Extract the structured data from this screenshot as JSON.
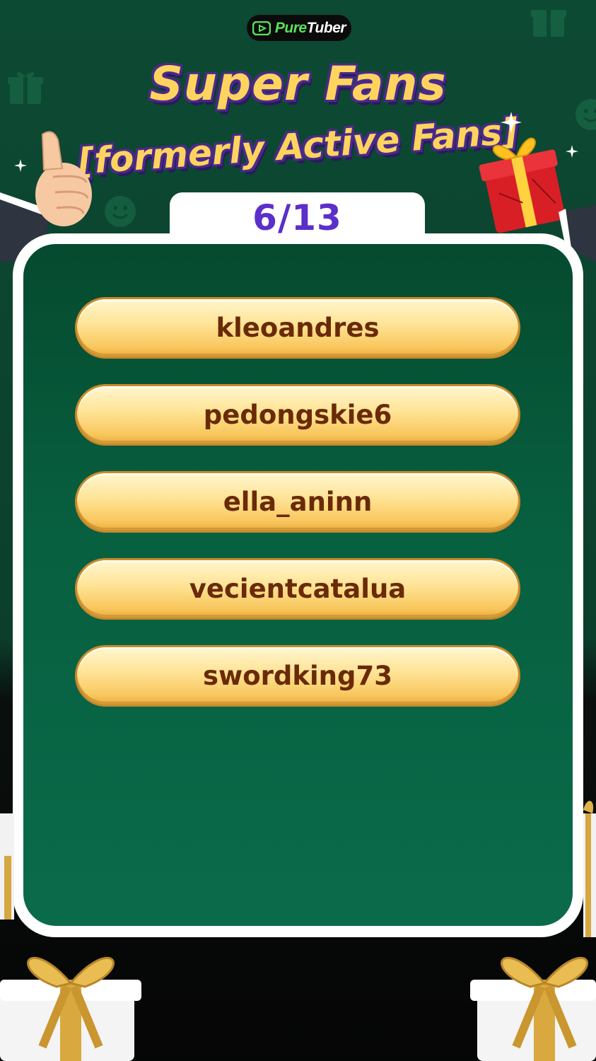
{
  "logo": {
    "brand_part1": "Pure",
    "brand_part2": "Tuber",
    "icon": "play-icon"
  },
  "title": {
    "line1": "Super Fans",
    "line2": "[formerly Active Fans]"
  },
  "counter": {
    "text": "6/13"
  },
  "fans": [
    {
      "name": "kleoandres"
    },
    {
      "name": "pedongskie6"
    },
    {
      "name": "ella_aninn"
    },
    {
      "name": "vecientcatalua"
    },
    {
      "name": "swordking73"
    }
  ],
  "decorations": {
    "left": "thumbs-up-icon",
    "right": "gift-box-icon",
    "bottom": "gift-box-icon"
  },
  "colors": {
    "background": "#0d4a33",
    "panel": "#075f3f",
    "button_gold": "#ffe394",
    "button_text": "#6a2a08",
    "counter_text": "#5b2fc9",
    "title_fill": "#ffd45e",
    "title_outline": "#4a2a8a"
  }
}
